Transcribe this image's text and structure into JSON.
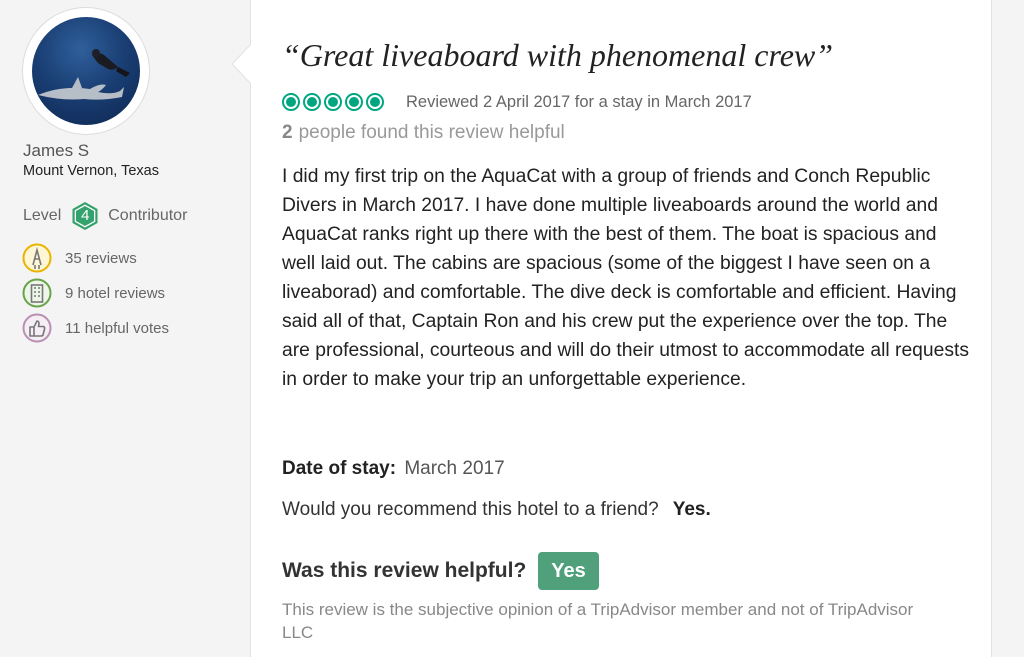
{
  "user": {
    "name": "James S",
    "location": "Mount Vernon, Texas",
    "level_label": "Level",
    "level_number": "4",
    "level_title": "Contributor",
    "stats": [
      {
        "icon": "pen-icon",
        "text": "35 reviews",
        "color": "#e8b400"
      },
      {
        "icon": "hotel-icon",
        "text": "9 hotel reviews",
        "color": "#66a34a"
      },
      {
        "icon": "thumbs-up-icon",
        "text": "11 helpful votes",
        "color": "#b98fb3"
      }
    ]
  },
  "review": {
    "title": "“Great liveaboard with phenomenal crew”",
    "rating_bubbles": 5,
    "reviewed_text": "Reviewed 2 April 2017 for a stay in March 2017",
    "helpful_number": "2",
    "helpful_text": "people found this review helpful",
    "body": "I did my first trip on the AquaCat with a group of friends and Conch Republic Divers in March 2017. I have done multiple liveaboards around the world and AquaCat ranks right up there with the best of them. The boat is spacious and well laid out. The cabins are spacious (some of the biggest I have seen on a liveaborad) and comfortable. The dive deck is comfortable and efficient. Having said all of that, Captain Ron and his crew put the experience over the top. The are professional, courteous and will do their utmost to accommodate all requests in order to make your trip an unforgettable experience.",
    "date_label": "Date of stay:",
    "date_value": "March 2017",
    "recommend_question": "Would you recommend this hotel to a friend?",
    "recommend_answer": "Yes.",
    "was_helpful_label": "Was this review helpful?",
    "yes_button": "Yes",
    "disclaimer": "This review is the subjective opinion of a TripAdvisor member and not of TripAdvisor LLC"
  },
  "colors": {
    "bubble": "#00a680",
    "level_badge": "#34a26d",
    "yes_button": "#4fa07b"
  }
}
